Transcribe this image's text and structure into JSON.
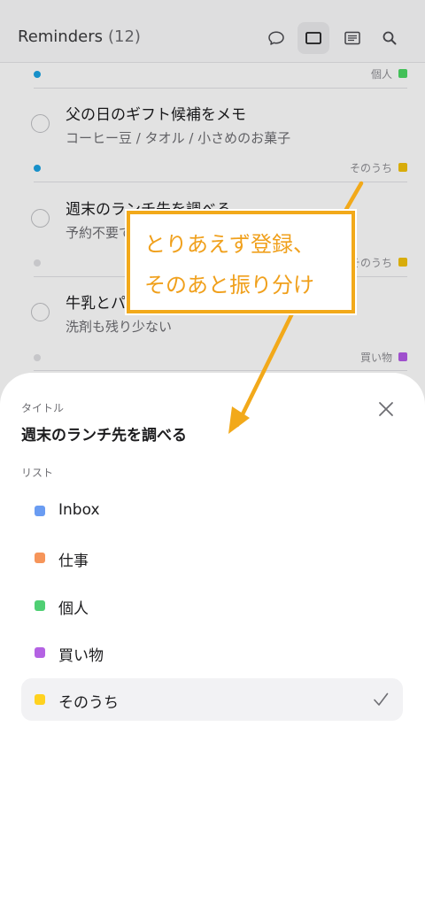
{
  "header": {
    "title": "Reminders",
    "count": "(12)"
  },
  "list": {
    "sections": [
      {
        "tag": "個人",
        "dot_color": "#1aa3e3",
        "tag_color": "#4cd964"
      },
      {
        "tag": "そのうち",
        "dot_color": "#1aa3e3",
        "tag_color": "#f4c20d"
      },
      {
        "tag": "そのうち",
        "dot_color": "#e0e0e3",
        "tag_color": "#f4c20d"
      },
      {
        "tag": "買い物",
        "dot_color": "#e0e0e3",
        "tag_color": "#b45be8"
      }
    ],
    "items": [
      {
        "title": "父の日のギフト候補をメモ",
        "note": "コーヒー豆 / タオル / 小さめのお菓子"
      },
      {
        "title": "週末のランチ先を調べる",
        "note": "予約不要で"
      },
      {
        "title": "牛乳とパン",
        "note": "洗剤も残り少ない"
      }
    ]
  },
  "sheet": {
    "title_label": "タイトル",
    "task_title": "週末のランチ先を調べる",
    "list_label": "リスト",
    "options": [
      {
        "name": "Inbox",
        "color": "#6a9cf2"
      },
      {
        "name": "仕事",
        "color": "#f6955a"
      },
      {
        "name": "個人",
        "color": "#4fcf73"
      },
      {
        "name": "買い物",
        "color": "#b462e3"
      },
      {
        "name": "そのうち",
        "color": "#ffd21f"
      }
    ],
    "selected": "そのうち"
  },
  "annotation": {
    "line1": "とりあえず登録、",
    "line2": "そのあと振り分け",
    "color": "#f2a91a"
  },
  "icons": [
    "chat-bubble-icon",
    "card-view-icon",
    "list-view-icon",
    "search-icon",
    "close-icon",
    "checkmark-icon"
  ]
}
